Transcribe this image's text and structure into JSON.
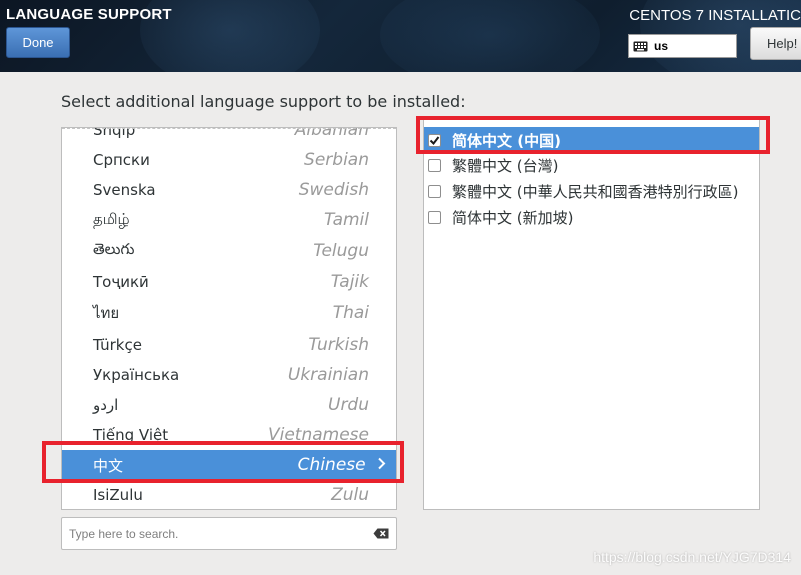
{
  "header": {
    "page_title": "LANGUAGE SUPPORT",
    "done_label": "Done",
    "product_title": "CENTOS 7 INSTALLATIC",
    "keyboard_layout": "us",
    "help_label": "Help!"
  },
  "prompt": "Select additional language support to be installed:",
  "languages": [
    {
      "native": "Shqip",
      "english": "Albanian"
    },
    {
      "native": "Српски",
      "english": "Serbian"
    },
    {
      "native": "Svenska",
      "english": "Swedish"
    },
    {
      "native": "தமிழ்",
      "english": "Tamil"
    },
    {
      "native": "తెలుగు",
      "english": "Telugu"
    },
    {
      "native": "Тоҷикӣ",
      "english": "Tajik"
    },
    {
      "native": "ไทย",
      "english": "Thai"
    },
    {
      "native": "Türkçe",
      "english": "Turkish"
    },
    {
      "native": "Українська",
      "english": "Ukrainian"
    },
    {
      "native": "اردو",
      "english": "Urdu"
    },
    {
      "native": "Tiếng Việt",
      "english": "Vietnamese"
    },
    {
      "native": "中文",
      "english": "Chinese",
      "selected": true
    },
    {
      "native": "IsiZulu",
      "english": "Zulu"
    }
  ],
  "search": {
    "placeholder": "Type here to search."
  },
  "locales": [
    {
      "label": "简体中文 (中国)",
      "checked": true,
      "selected": true
    },
    {
      "label": "繁體中文 (台灣)",
      "checked": false
    },
    {
      "label": "繁體中文 (中華人民共和國香港特別行政區)",
      "checked": false
    },
    {
      "label": "简体中文 (新加坡)",
      "checked": false
    }
  ],
  "watermark": "https://blog.csdn.net/YJG7D314",
  "colors": {
    "header_bg": "#14273b",
    "selection": "#4a90d9",
    "done_button": "#4a80c4",
    "highlight_box": "#e8222d"
  }
}
